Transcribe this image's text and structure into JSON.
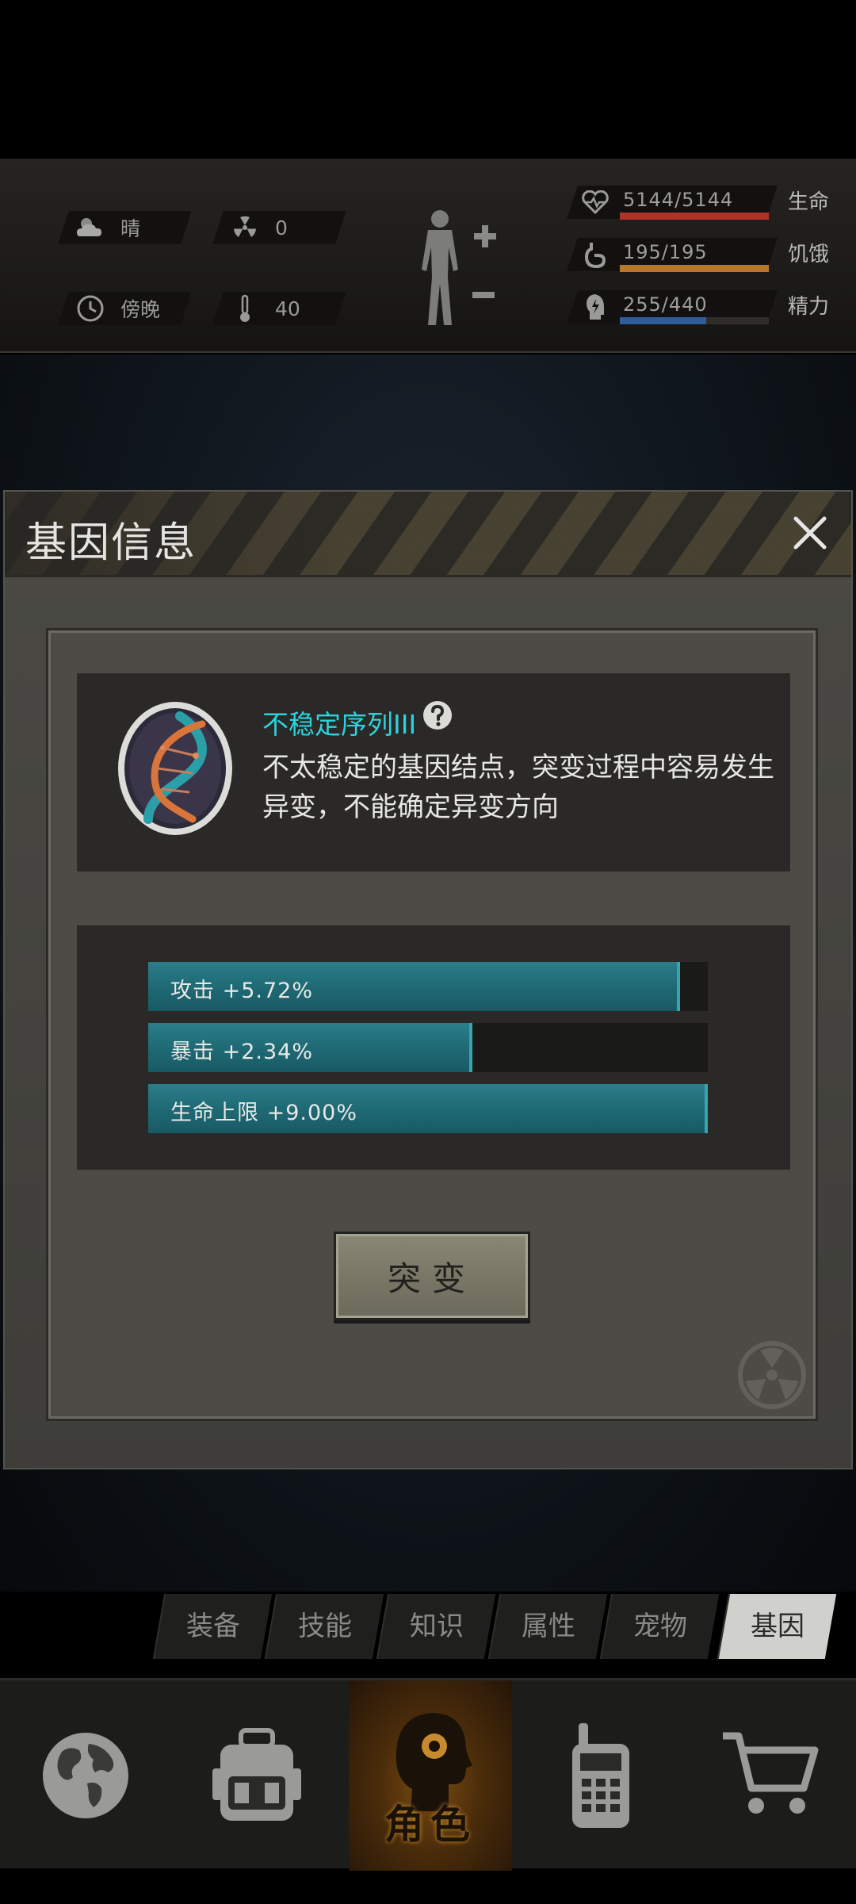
{
  "status": {
    "weather": "晴",
    "radiation": "0",
    "time_of_day": "傍晚",
    "temperature": "40",
    "stats": [
      {
        "label": "生命",
        "value": "5144/5144",
        "level": 1.0,
        "color": "#b0332a",
        "icon": "heart-icon"
      },
      {
        "label": "饥饿",
        "value": "195/195",
        "level": 1.0,
        "color": "#b5782a",
        "icon": "stomach-icon"
      },
      {
        "label": "精力",
        "value": "255/440",
        "level": 0.58,
        "color": "#2e5d9a",
        "icon": "energy-icon"
      }
    ]
  },
  "dialog": {
    "title": "基因信息",
    "gene_name": "不稳定序列III",
    "gene_description": "不太稳定的基因结点，突变过程中容易发生异变，不能确定异变方向",
    "attributes": [
      {
        "label": "攻击 +5.72%",
        "level": 0.95
      },
      {
        "label": "暴击 +2.34%",
        "level": 0.58
      },
      {
        "label": "生命上限 +9.00%",
        "level": 1.0
      }
    ],
    "mutate_button": "突变"
  },
  "subtabs": [
    "装备",
    "技能",
    "知识",
    "属性",
    "宠物",
    "基因"
  ],
  "active_subtab": "基因",
  "bottom_nav": {
    "active_label": "角色",
    "items": [
      "globe-icon",
      "backpack-icon",
      "character-icon",
      "radio-icon",
      "cart-icon"
    ]
  },
  "colors": {
    "accent_cyan": "#2bd3de",
    "bar_teal": "#1f6a75",
    "active_glow": "#d0932e"
  }
}
